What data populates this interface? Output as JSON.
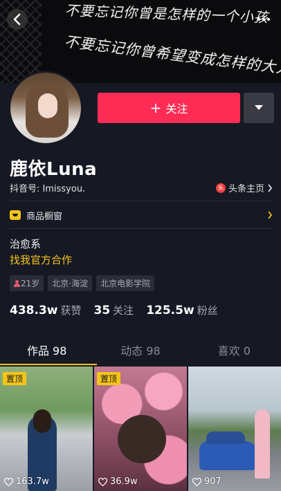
{
  "banner": {
    "line1": "不要忘记你曾是怎样的一个小孩",
    "line2": "不要忘记你曾希望变成怎样的大人"
  },
  "nav": {
    "back_icon": "chevron-left-icon",
    "more_icon": "more-dots-icon"
  },
  "actions": {
    "follow_label": "关注",
    "follow_color": "#fe2c55",
    "dropdown_icon": "caret-down-icon"
  },
  "profile": {
    "name": "鹿依Luna",
    "douyin_id": "抖音号: Imissyou.",
    "toutiao_label": "头条主页",
    "shop_label": "商品橱窗",
    "bio_line1": "治愈系",
    "bio_line2": "找我官方合作",
    "tags": {
      "age": "21岁",
      "location": "北京·海淀",
      "school": "北京电影学院"
    }
  },
  "stats": [
    {
      "num": "438.3w",
      "label": "获赞"
    },
    {
      "num": "35",
      "label": "关注"
    },
    {
      "num": "125.5w",
      "label": "粉丝"
    }
  ],
  "tabs": [
    {
      "label": "作品 98"
    },
    {
      "label": "动态 98"
    },
    {
      "label": "喜欢 0"
    }
  ],
  "videos": [
    {
      "pinned": "置顶",
      "likes": "163.7w"
    },
    {
      "pinned": "置顶",
      "likes": "36.9w"
    },
    {
      "likes": "907"
    }
  ],
  "colors": {
    "background": "#161823",
    "accent_yellow": "#f5c518",
    "follow_red": "#fe2c55"
  }
}
